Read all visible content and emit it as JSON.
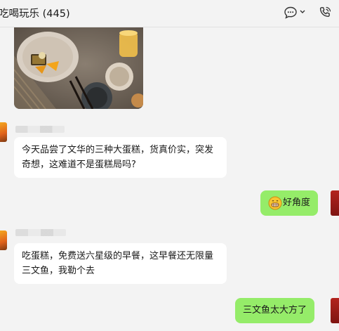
{
  "header": {
    "title": "吃喝玩乐 (445)",
    "icons": [
      "chat-bubble-icon",
      "chevron-down-icon",
      "phone-call-icon"
    ]
  },
  "messages": [
    {
      "side": "left",
      "type": "image",
      "icon": "food-photo"
    },
    {
      "side": "left",
      "text": "今天品尝了文华的三种大蛋糕，货真价实，突发奇想，这难道不是蛋糕局吗?"
    },
    {
      "side": "right",
      "emoji": "grinning-face-icon",
      "text": "好角度"
    },
    {
      "side": "left",
      "text": "吃蛋糕，免费送六星级的早餐，这早餐还无限量三文鱼，我勒个去"
    },
    {
      "side": "right",
      "text": "三文鱼太大方了"
    }
  ],
  "colors": {
    "background": "#f3f3f3",
    "incoming_bubble": "#ffffff",
    "outgoing_bubble": "#95ec69"
  }
}
